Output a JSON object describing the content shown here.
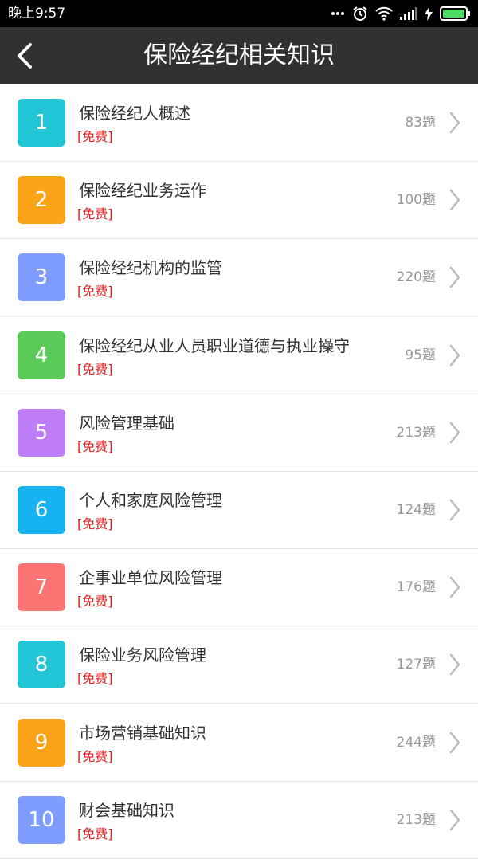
{
  "status_bar": {
    "time": "晚上9:57",
    "icons": [
      "more-dots-icon",
      "alarm-icon",
      "wifi-icon",
      "signal-icon",
      "charging-icon",
      "battery-icon"
    ]
  },
  "header": {
    "title": "保险经纪相关知识",
    "back_icon": "chevron-left-icon"
  },
  "items": [
    {
      "number": "1",
      "title": "保险经纪人概述",
      "tag": "[免费]",
      "count": "83题",
      "color": "#22c6d6"
    },
    {
      "number": "2",
      "title": "保险经纪业务运作",
      "tag": "[免费]",
      "count": "100题",
      "color": "#fba418"
    },
    {
      "number": "3",
      "title": "保险经纪机构的监管",
      "tag": "[免费]",
      "count": "220题",
      "color": "#7f9cff"
    },
    {
      "number": "4",
      "title": "保险经纪从业人员职业道德与执业操守",
      "tag": "[免费]",
      "count": "95题",
      "color": "#5cca58"
    },
    {
      "number": "5",
      "title": "风险管理基础",
      "tag": "[免费]",
      "count": "213题",
      "color": "#c07df8"
    },
    {
      "number": "6",
      "title": "个人和家庭风险管理",
      "tag": "[免费]",
      "count": "124题",
      "color": "#17b2f0"
    },
    {
      "number": "7",
      "title": "企事业单位风险管理",
      "tag": "[免费]",
      "count": "176题",
      "color": "#fb7474"
    },
    {
      "number": "8",
      "title": "保险业务风险管理",
      "tag": "[免费]",
      "count": "127题",
      "color": "#22c6d6"
    },
    {
      "number": "9",
      "title": "市场营销基础知识",
      "tag": "[免费]",
      "count": "244题",
      "color": "#fba418"
    },
    {
      "number": "10",
      "title": "财会基础知识",
      "tag": "[免费]",
      "count": "213题",
      "color": "#7f9cff"
    }
  ]
}
